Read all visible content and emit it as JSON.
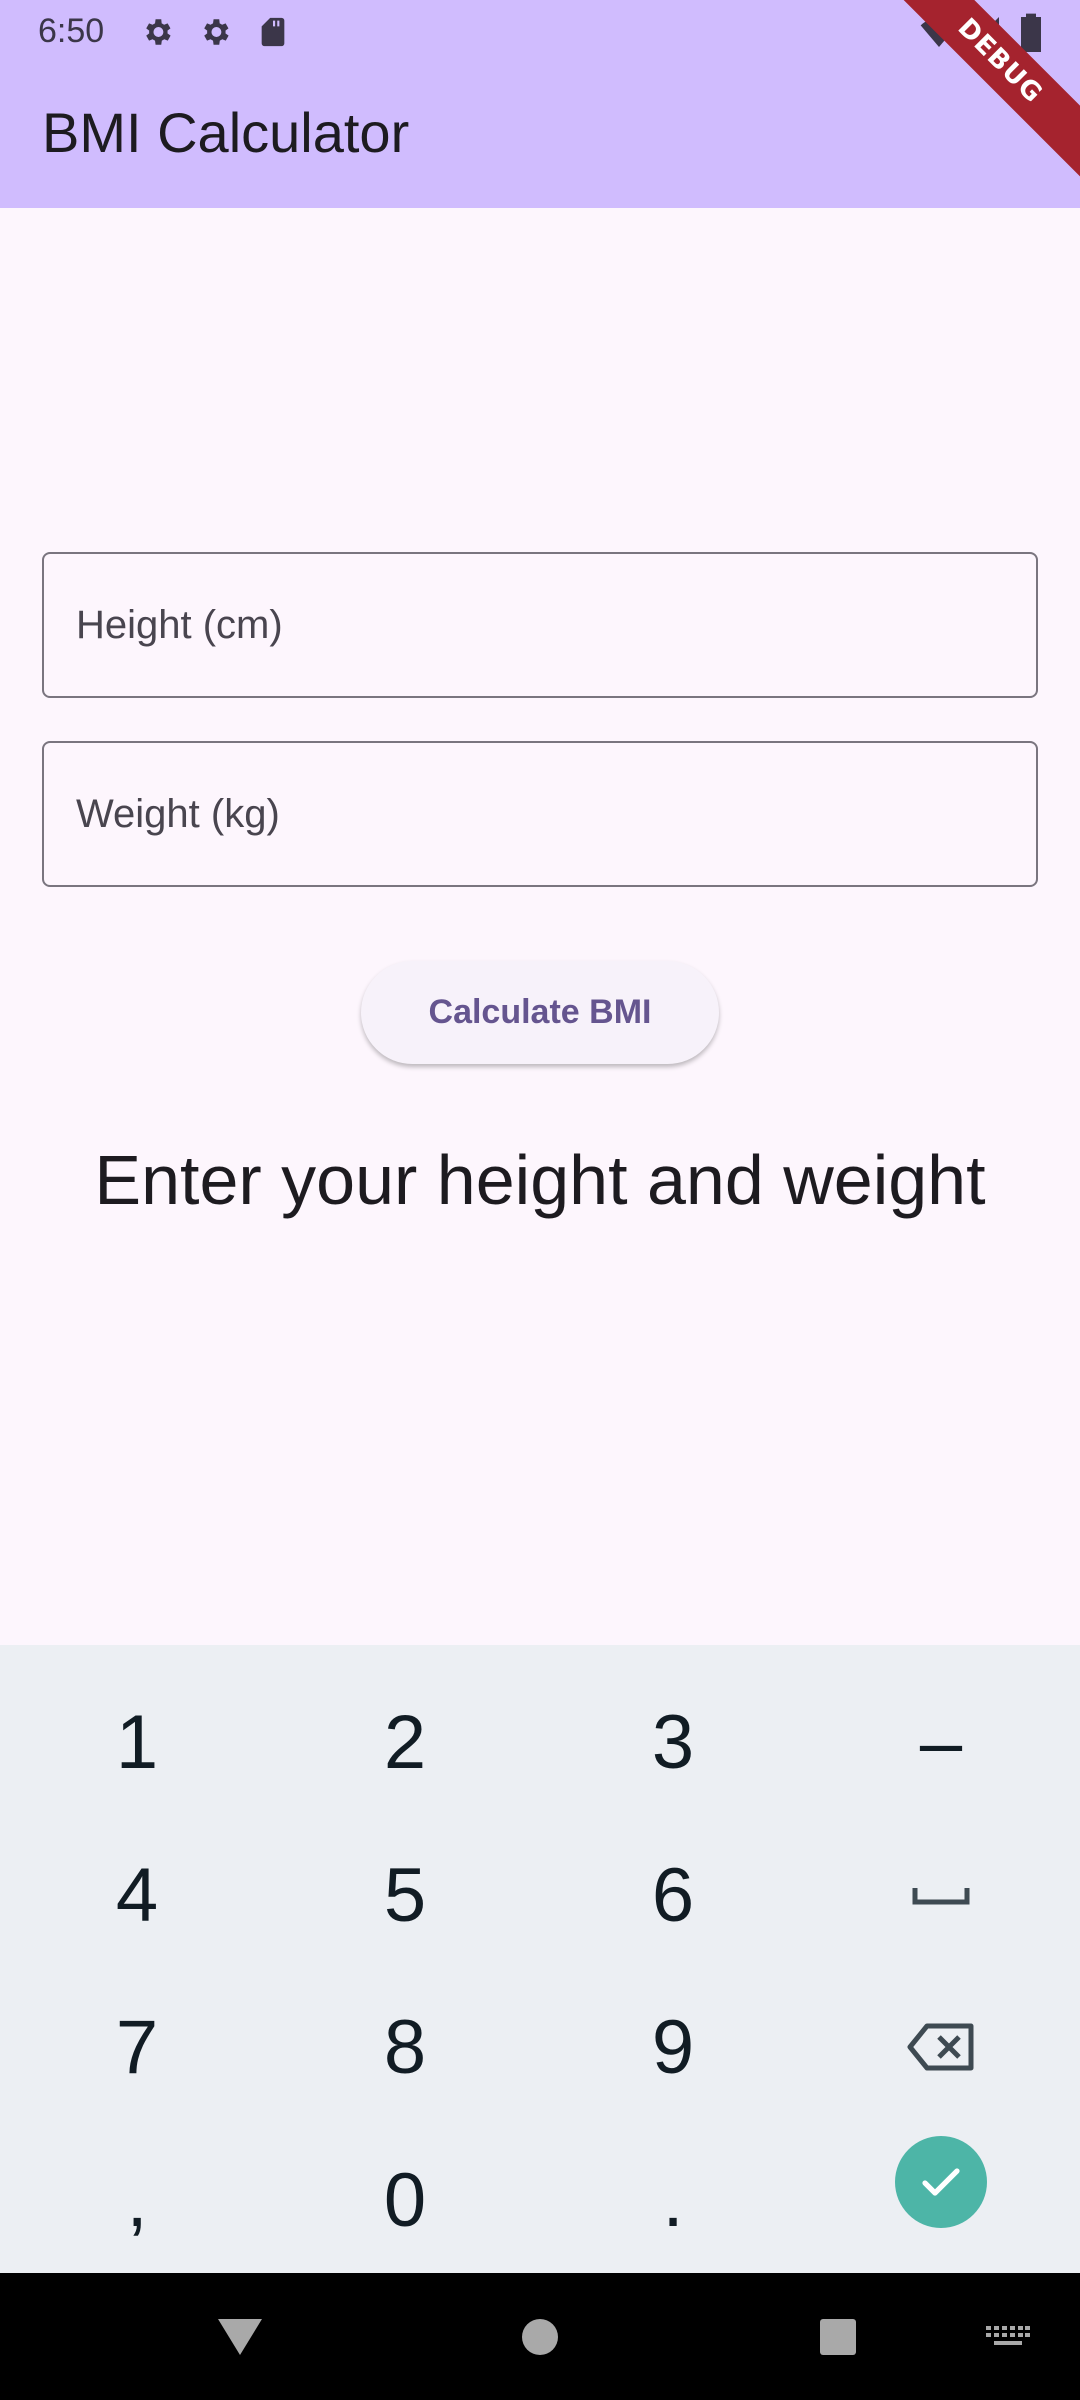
{
  "status_bar": {
    "time": "6:50",
    "icons": [
      "gear-icon",
      "gear-icon",
      "sd-card-icon",
      "wifi-icon",
      "signal-icon",
      "battery-icon"
    ]
  },
  "app_bar": {
    "title": "BMI Calculator",
    "color": "#d0bcfe"
  },
  "debug_banner": "DEBUG",
  "form": {
    "height_placeholder": "Height (cm)",
    "weight_placeholder": "Weight (kg)",
    "calculate_label": "Calculate BMI"
  },
  "result_text": "Enter your height and weight",
  "keyboard": {
    "keys": [
      "1",
      "2",
      "3",
      "–",
      "4",
      "5",
      "6",
      "␣",
      "7",
      "8",
      "9",
      "⌫",
      ",",
      "0",
      ".",
      "✓"
    ],
    "done_color": "#4db5a7"
  },
  "nav_bar": {
    "items": [
      "back-icon",
      "home-icon",
      "recents-icon",
      "keyboard-icon"
    ]
  }
}
